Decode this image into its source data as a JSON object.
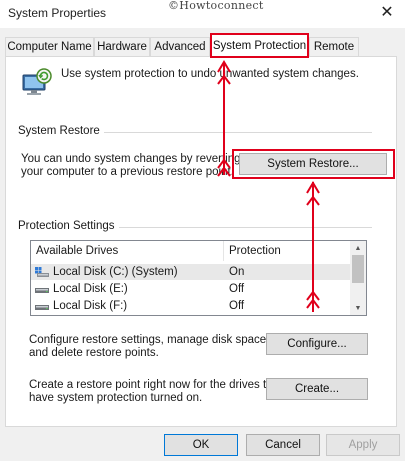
{
  "window": {
    "title": "System Properties",
    "watermark": "©Howtoconnect",
    "close_glyph": "✕"
  },
  "tabs": [
    {
      "label": "Computer Name",
      "active": false
    },
    {
      "label": "Hardware",
      "active": false
    },
    {
      "label": "Advanced",
      "active": false
    },
    {
      "label": "System Protection",
      "active": true
    },
    {
      "label": "Remote",
      "active": false
    }
  ],
  "intro": {
    "icon": "system-protection-icon",
    "text": "Use system protection to undo unwanted system changes."
  },
  "system_restore": {
    "group_label": "System Restore",
    "description_line1": "You can undo system changes by reverting",
    "description_line2": "your computer to a previous restore point.",
    "button_label": "System Restore..."
  },
  "protection_settings": {
    "group_label": "Protection Settings",
    "columns": [
      "Available Drives",
      "Protection"
    ],
    "drives": [
      {
        "name": "Local Disk (C:) (System)",
        "protection": "On",
        "icon": "system-drive-icon",
        "selected": true
      },
      {
        "name": "Local Disk (E:)",
        "protection": "Off",
        "icon": "drive-icon",
        "selected": false
      },
      {
        "name": "Local Disk (F:)",
        "protection": "Off",
        "icon": "drive-icon",
        "selected": false
      }
    ],
    "configure_text_line1": "Configure restore settings, manage disk space,",
    "configure_text_line2": "and delete restore points.",
    "configure_button": "Configure...",
    "create_text_line1": "Create a restore point right now for the drives that",
    "create_text_line2": "have system protection turned on.",
    "create_button": "Create..."
  },
  "footer": {
    "ok": "OK",
    "cancel": "Cancel",
    "apply": "Apply"
  },
  "colors": {
    "highlight": "#e0001b",
    "dialog_bg": "#f0f0f0",
    "panel_bg": "#ffffff"
  }
}
